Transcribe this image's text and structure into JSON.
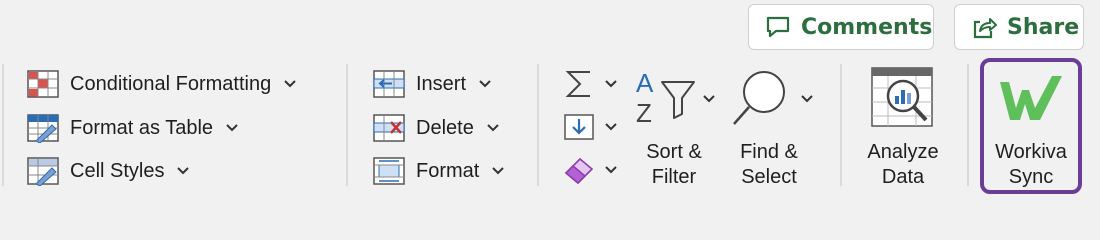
{
  "header": {
    "comments_label": "Comments",
    "share_label": "Share"
  },
  "cells_styles": {
    "conditional_formatting": "Conditional Formatting",
    "format_as_table": "Format as Table",
    "cell_styles": "Cell Styles"
  },
  "cells": {
    "insert": "Insert",
    "delete": "Delete",
    "format": "Format"
  },
  "editing": {
    "sort_filter_line1": "Sort &",
    "sort_filter_line2": "Filter",
    "find_select_line1": "Find &",
    "find_select_line2": "Select"
  },
  "analysis": {
    "analyze_line1": "Analyze",
    "analyze_line2": "Data"
  },
  "addin": {
    "workiva_line1": "Workiva",
    "workiva_line2": "Sync",
    "logo_text": "W"
  },
  "colors": {
    "accent_green": "#2c6e3d",
    "workiva_green": "#5fbf5a",
    "workiva_border": "#6a3d97",
    "icon_blue": "#2a6cb5",
    "icon_red": "#c8332c"
  }
}
